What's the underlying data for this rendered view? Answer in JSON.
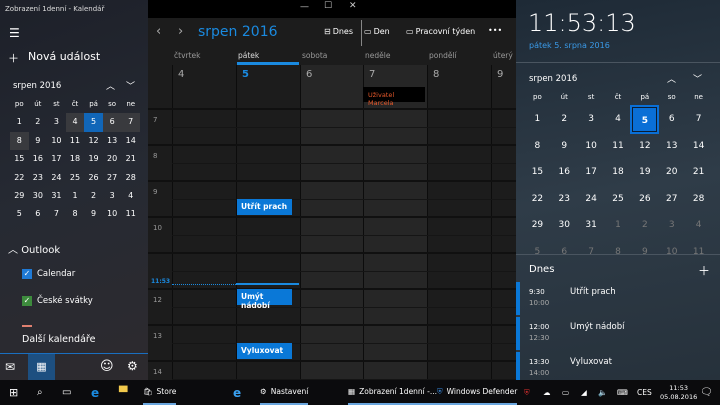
{
  "window_title": "Zobrazení 1denní - Kalendář",
  "left": {
    "new_event": "Nová událost",
    "month": "srpen 2016",
    "weekdays": [
      "po",
      "út",
      "st",
      "čt",
      "pá",
      "so",
      "ne"
    ],
    "days": [
      "1",
      "2",
      "3",
      "4",
      "5",
      "6",
      "7",
      "8",
      "9",
      "10",
      "11",
      "12",
      "13",
      "14",
      "15",
      "16",
      "17",
      "18",
      "19",
      "20",
      "21",
      "22",
      "23",
      "24",
      "25",
      "26",
      "27",
      "28",
      "29",
      "30",
      "31",
      "1",
      "2",
      "3",
      "4",
      "5",
      "6",
      "7",
      "8",
      "9",
      "10",
      "11"
    ],
    "account": "Outlook",
    "calendars": [
      {
        "label": "Calendar",
        "color": "#1f7ad6"
      },
      {
        "label": "České svátky",
        "color": "#3d8b3d"
      }
    ],
    "more": "Další kalendáře"
  },
  "header": {
    "month": "srpen 2016",
    "today": "Dnes",
    "day": "Den",
    "workweek": "Pracovní týden",
    "more": "•••"
  },
  "columns": [
    {
      "name": "čtvrtek",
      "num": "4"
    },
    {
      "name": "pátek",
      "num": "5"
    },
    {
      "name": "sobota",
      "num": "6"
    },
    {
      "name": "neděle",
      "num": "7"
    },
    {
      "name": "pondělí",
      "num": "8"
    },
    {
      "name": "úterý",
      "num": "9"
    }
  ],
  "allday_event": "Uživatel Marcela",
  "hours": [
    "7",
    "8",
    "9",
    "10",
    "",
    "12",
    "13",
    "14"
  ],
  "now": "11:53",
  "events": [
    "Utřít prach",
    "Umýt nádobí",
    "Vyluxovat"
  ],
  "flyout": {
    "time": "11:53:13",
    "date": "pátek 5. srpna 2016",
    "month": "srpen 2016",
    "today": "Dnes",
    "agenda": [
      {
        "start": "9:30",
        "end": "10:00",
        "title": "Utřít prach"
      },
      {
        "start": "12:00",
        "end": "12:30",
        "title": "Umýt nádobí"
      },
      {
        "start": "13:30",
        "end": "14:00",
        "title": "Vyluxovat"
      }
    ]
  },
  "taskbar": {
    "store": "Store",
    "settings": "Nastavení",
    "calendar": "Zobrazení 1denní -...",
    "defender": "Windows Defender",
    "lang": "CES",
    "time": "11:53",
    "date": "05.08.2016"
  },
  "colors": {
    "accent": "#0a78d7",
    "holiday": "#e5582a"
  }
}
